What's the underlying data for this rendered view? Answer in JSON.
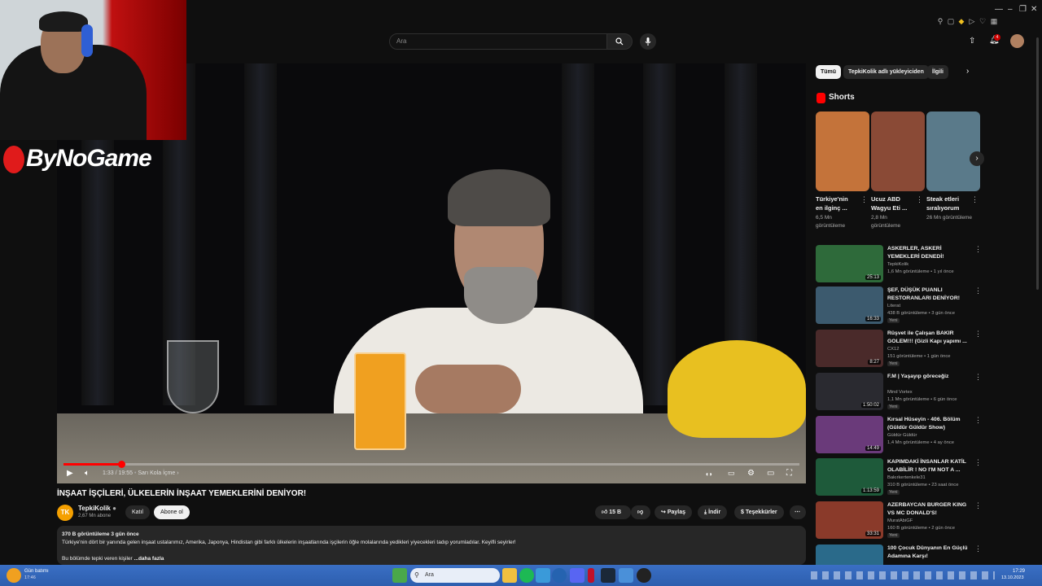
{
  "search": {
    "placeholder": "Ara"
  },
  "notifications": {
    "count": "4"
  },
  "player": {
    "current_time": "1:33 / 19:55",
    "chapter": "Sarı Kola İçme",
    "progress_fraction": 0.078
  },
  "overlay": {
    "logo_text": "ByNoGame"
  },
  "video": {
    "title": "İNŞAAT İŞÇİLERİ, ÜLKELERİN İNŞAAT YEMEKLERİNİ DENİYOR!",
    "channel_initials": "TK",
    "channel_name": "TepkiKolik",
    "subscribers": "2,67 Mn abone",
    "join_label": "Katıl",
    "subscribe_label": "Abone ol",
    "like_count": "15 B",
    "share_label": "Paylaş",
    "download_label": "İndir",
    "thanks_label": "Teşekkürler",
    "views_date": "370 B görüntüleme  3 gün önce",
    "description": "Türkiye'nin dört bir yanında gelen inşaat ustalarımız, Amerika, Japonya, Hindistan gibi farklı ülkelerin inşaatlarında işçilerin öğle molalarında yedikleri yiyecekleri tadıp yorumladılar. Keyifli seyirler!",
    "description_line2": "Bu bölümde tepki veren kişiler",
    "more_label": "...daha fazla"
  },
  "chips": [
    "Tümü",
    "TepkiKolik adlı yükleyiciden",
    "İlgili"
  ],
  "shorts": {
    "heading": "Shorts",
    "items": [
      {
        "title": "Türkiye'nin en ilginç ...",
        "views": "6,5 Mn görüntüleme",
        "color": "#c4733a"
      },
      {
        "title": "Ucuz ABD Wagyu Eti ...",
        "views": "2,8 Mn görüntüleme",
        "color": "#8a4a36"
      },
      {
        "title": "Steak etleri sıralıyorum",
        "views": "26 Mn görüntüleme",
        "color": "#5a7a8a"
      }
    ]
  },
  "recommendations": [
    {
      "title": "ASKERLER, ASKERİ YEMEKLERİ DENEDİ!",
      "channel": "TepkiKolik",
      "meta": "1,6 Mn görüntüleme • 1 yıl önce",
      "duration": "25:13",
      "new": "",
      "color": "#2e6a3a"
    },
    {
      "title": "ŞEF, DÜŞÜK PUANLI RESTORANLARI DENİYOR!",
      "channel": "Literat",
      "meta": "438 B görüntüleme • 3 gün önce",
      "duration": "16:33",
      "new": "Yeni",
      "color": "#3c5a6e"
    },
    {
      "title": "Rüşvet ile Çalışan BAKIR GOLEM!!! (Gizli Kapı yapımı ...",
      "channel": "CX12",
      "meta": "151 görüntüleme • 1 gün önce",
      "duration": "8:27",
      "new": "Yeni",
      "color": "#4a2a2a"
    },
    {
      "title": "F.M | Yaşayıp göreceğiz",
      "channel": "Mind Vortex",
      "meta": "1,1 Mn görüntüleme • 6 gün önce",
      "duration": "1:50:02",
      "new": "Yeni",
      "color": "#2a2a30"
    },
    {
      "title": "Kırsal Hüseyin - 406. Bölüm (Güldür Güldür Show)",
      "channel": "Güldür Güldür",
      "meta": "1,4 Mn görüntüleme • 4 ay önce",
      "duration": "14:49",
      "new": "",
      "color": "#6a3a7a"
    },
    {
      "title": "KAPIMDAKİ İNSANLAR KATİL OLABİLİR ! NO I'M NOT A ...",
      "channel": "Bakırkertenkele31",
      "meta": "310 B görüntüleme • 23 saat önce",
      "duration": "1:13:59",
      "new": "Yeni",
      "color": "#1e5a3a"
    },
    {
      "title": "AZERBAYCAN BURGER KING VS MC DONALD'S!",
      "channel": "MuratAbiGF",
      "meta": "160 B görüntüleme • 2 gün önce",
      "duration": "33:31",
      "new": "Yeni",
      "color": "#8a3a2a"
    },
    {
      "title": "100 Çocuk Dünyanın En Güçlü Adamına Karşı!",
      "channel": "",
      "meta": "",
      "duration": "",
      "new": "",
      "color": "#2a6a8a"
    }
  ],
  "taskbar": {
    "weather_line1": "Gün batımı",
    "weather_line2": "17:46",
    "search_placeholder": "Ara",
    "time": "17:29",
    "date": "13.10.2023"
  }
}
